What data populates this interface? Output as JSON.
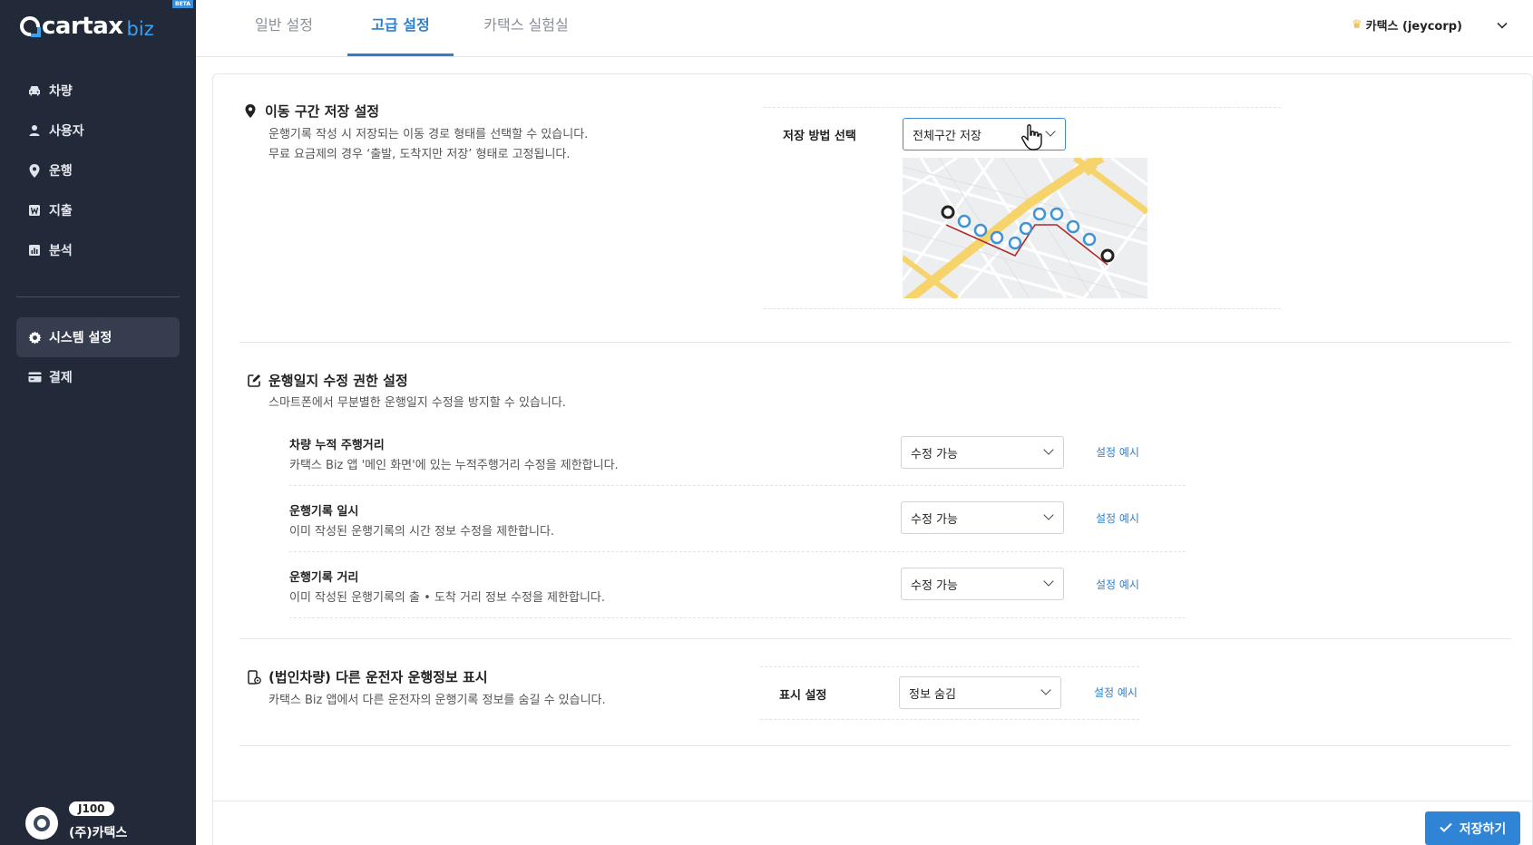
{
  "brand": {
    "name": "cartax",
    "suffix": "biz",
    "badge": "BETA"
  },
  "sidebar": {
    "items": [
      {
        "label": "차량",
        "icon": "car-icon"
      },
      {
        "label": "사용자",
        "icon": "user-icon"
      },
      {
        "label": "운행",
        "icon": "location-pin-icon"
      },
      {
        "label": "지출",
        "icon": "receipt-icon"
      },
      {
        "label": "분석",
        "icon": "chart-icon"
      }
    ],
    "settings": [
      {
        "label": "시스템 설정",
        "icon": "gear-icon",
        "active": true
      },
      {
        "label": "결제",
        "icon": "card-icon"
      }
    ]
  },
  "profile": {
    "plan": "J100",
    "company": "(주)카택스"
  },
  "tabs": [
    {
      "label": "일반 설정",
      "active": false
    },
    {
      "label": "고급 설정",
      "active": true
    },
    {
      "label": "카택스 실험실",
      "active": false
    }
  ],
  "user_menu": {
    "label": "카택스 (jeycorp)"
  },
  "section_route": {
    "title": "이동 구간 저장 설정",
    "desc1": "운행기록 작성 시 저장되는 이동 경로 형태를 선택할 수 있습니다.",
    "desc2": "무료 요금제의 경우 ‘출발, 도착지만 저장’ 형태로 고정됩니다.",
    "field_label": "저장 방법 선택",
    "selected": "전체구간 저장"
  },
  "section_edit": {
    "title": "운행일지 수정 권한 설정",
    "desc": "스마트폰에서 무분별한 운행일지 수정을 방지할 수 있습니다.",
    "rows": [
      {
        "title": "차량 누적 주행거리",
        "desc": "카택스 Biz 앱 '메인 화면'에 있는 누적주행거리 수정을 제한합니다.",
        "value": "수정 가능",
        "link": "설정 예시"
      },
      {
        "title": "운행기록 일시",
        "desc": "이미 작성된 운행기록의 시간 정보 수정을 제한합니다.",
        "value": "수정 가능",
        "link": "설정 예시"
      },
      {
        "title": "운행기록 거리",
        "desc": "이미 작성된 운행기록의 출 • 도착 거리 정보 수정을 제한합니다.",
        "value": "수정 가능",
        "link": "설정 예시"
      }
    ]
  },
  "section_display": {
    "title": "(법인차량) 다른 운전자 운행정보 표시",
    "desc": "카택스 Biz 앱에서 다른 운전자의 운행기록 정보를 숨길 수 있습니다.",
    "field_label": "표시 설정",
    "selected": "정보 숨김",
    "link": "설정 예시"
  },
  "save_button": {
    "label": "저장하기"
  },
  "colors": {
    "sidebar": "#222a3a",
    "accent": "#2f7fd1",
    "save": "#2f84d6"
  }
}
